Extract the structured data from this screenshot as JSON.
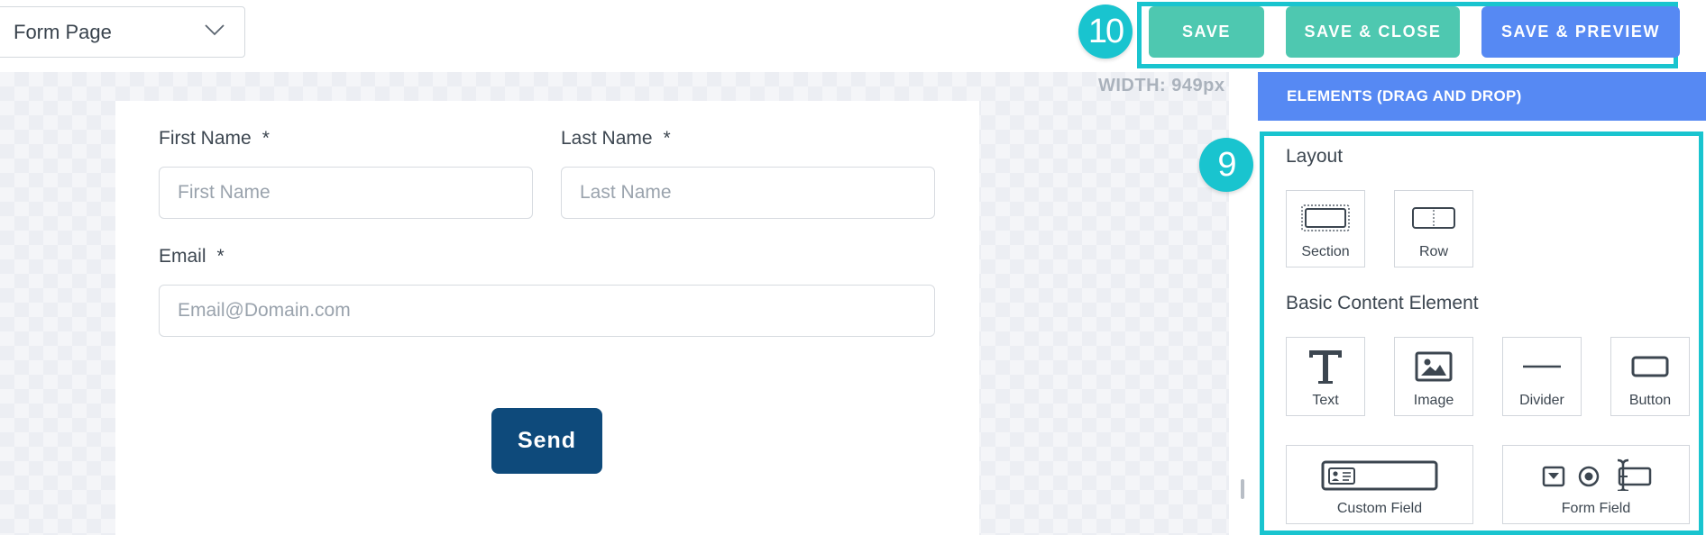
{
  "top_bar": {
    "page_select": {
      "value": "Form Page",
      "icon": "chevron-down-icon"
    },
    "buttons": {
      "save": "SAVE",
      "save_close": "SAVE & CLOSE",
      "save_preview": "SAVE & PREVIEW"
    },
    "annotation_badge": "10",
    "colors": {
      "save": "#4ec8b0",
      "save_preview": "#5689f3",
      "annotation": "#19c4cf"
    }
  },
  "canvas": {
    "width_label": "WIDTH: 949px",
    "form": {
      "first_name": {
        "label": "First Name",
        "required": "*",
        "placeholder": "First Name"
      },
      "last_name": {
        "label": "Last Name",
        "required": "*",
        "placeholder": "Last Name"
      },
      "email": {
        "label": "Email",
        "required": "*",
        "placeholder": "Email@Domain.com"
      },
      "send_label": "Send",
      "send_color": "#0e4a7b"
    }
  },
  "panel": {
    "header": "ELEMENTS (DRAG AND DROP)",
    "annotation_badge": "9",
    "layout_title": "Layout",
    "layout_items": [
      {
        "label": "Section",
        "icon": "section-icon"
      },
      {
        "label": "Row",
        "icon": "row-icon"
      }
    ],
    "basic_title": "Basic Content Element",
    "basic_items": [
      {
        "label": "Text",
        "icon": "text-icon"
      },
      {
        "label": "Image",
        "icon": "image-icon"
      },
      {
        "label": "Divider",
        "icon": "divider-icon"
      },
      {
        "label": "Button",
        "icon": "button-icon"
      },
      {
        "label": "Custom Field",
        "icon": "custom-field-icon"
      },
      {
        "label": "Form Field",
        "icon": "form-field-icon"
      }
    ]
  }
}
